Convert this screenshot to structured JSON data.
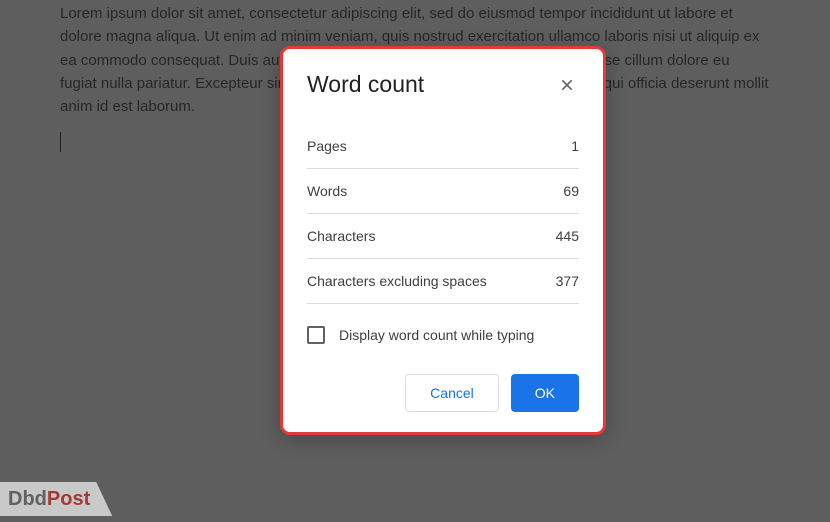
{
  "document": {
    "body_text": "Lorem ipsum dolor sit amet, consectetur adipiscing elit, sed do eiusmod tempor incididunt ut labore et dolore magna aliqua. Ut enim ad minim veniam, quis nostrud exercitation ullamco laboris nisi ut aliquip ex ea commodo consequat. Duis aute irure dolor in reprehenderit in voluptate velit esse cillum dolore eu fugiat nulla pariatur. Excepteur sint occaecat cupidatat non proident, sunt in culpa qui officia deserunt mollit anim id est laborum."
  },
  "dialog": {
    "title": "Word count",
    "stats": {
      "pages_label": "Pages",
      "pages_value": "1",
      "words_label": "Words",
      "words_value": "69",
      "chars_label": "Characters",
      "chars_value": "445",
      "chars_ns_label": "Characters excluding spaces",
      "chars_ns_value": "377"
    },
    "checkbox_label": "Display word count while typing",
    "checkbox_checked": false,
    "buttons": {
      "cancel": "Cancel",
      "ok": "OK"
    }
  },
  "watermark": {
    "part1": "Dbd",
    "part2": "Post"
  }
}
